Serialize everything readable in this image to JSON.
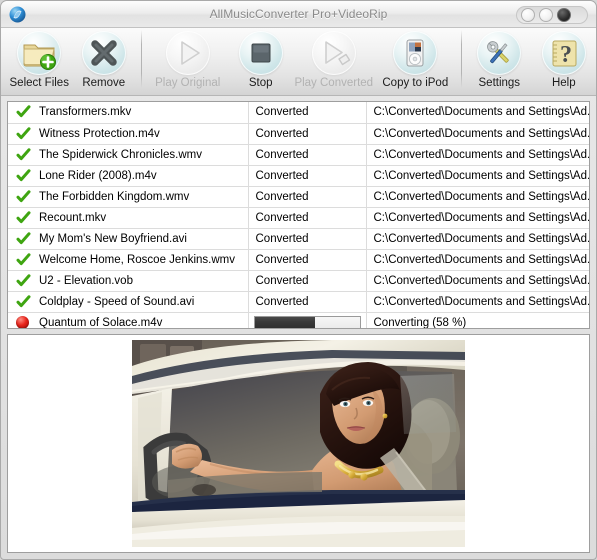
{
  "window": {
    "title": "AllMusicConverter Pro+VideoRip",
    "logo_icon": "app-logo-icon",
    "controls": [
      {
        "name": "minimize-button",
        "icon": "minimize-icon"
      },
      {
        "name": "maximize-button",
        "icon": "maximize-icon"
      },
      {
        "name": "close-button",
        "icon": "close-icon"
      }
    ]
  },
  "toolbar": {
    "items": [
      {
        "label": "Select Files",
        "icon": "folder-add-icon",
        "enabled": true,
        "name": "select-files-button"
      },
      {
        "label": "Remove",
        "icon": "x-cross-icon",
        "enabled": true,
        "name": "remove-button"
      },
      {
        "label": "Play Original",
        "icon": "play-triangle-icon",
        "enabled": false,
        "name": "play-original-button"
      },
      {
        "label": "Stop",
        "icon": "stop-square-icon",
        "enabled": true,
        "name": "stop-button"
      },
      {
        "label": "Play Converted",
        "icon": "play-converted-icon",
        "enabled": false,
        "name": "play-converted-button"
      },
      {
        "label": "Copy to iPod",
        "icon": "ipod-icon",
        "enabled": true,
        "name": "copy-to-ipod-button"
      },
      {
        "label": "Settings",
        "icon": "tools-icon",
        "enabled": true,
        "name": "settings-button"
      },
      {
        "label": "Help",
        "icon": "question-mark-icon",
        "enabled": true,
        "name": "help-button"
      }
    ]
  },
  "file_list": {
    "rows": [
      {
        "status_icon": "green-check-icon",
        "name": "Transformers.mkv",
        "status": "Converted",
        "path": "C:\\Converted\\Documents and Settings\\Ad..."
      },
      {
        "status_icon": "green-check-icon",
        "name": "Witness Protection.m4v",
        "status": "Converted",
        "path": "C:\\Converted\\Documents and Settings\\Ad..."
      },
      {
        "status_icon": "green-check-icon",
        "name": "The Spiderwick Chronicles.wmv",
        "status": "Converted",
        "path": "C:\\Converted\\Documents and Settings\\Ad..."
      },
      {
        "status_icon": "green-check-icon",
        "name": "Lone Rider (2008).m4v",
        "status": "Converted",
        "path": "C:\\Converted\\Documents and Settings\\Ad..."
      },
      {
        "status_icon": "green-check-icon",
        "name": "The Forbidden Kingdom.wmv",
        "status": "Converted",
        "path": "C:\\Converted\\Documents and Settings\\Ad..."
      },
      {
        "status_icon": "green-check-icon",
        "name": "Recount.mkv",
        "status": "Converted",
        "path": "C:\\Converted\\Documents and Settings\\Ad..."
      },
      {
        "status_icon": "green-check-icon",
        "name": "My Mom's New Boyfriend.avi",
        "status": "Converted",
        "path": "C:\\Converted\\Documents and Settings\\Ad..."
      },
      {
        "status_icon": "green-check-icon",
        "name": "Welcome Home, Roscoe Jenkins.wmv",
        "status": "Converted",
        "path": "C:\\Converted\\Documents and Settings\\Ad..."
      },
      {
        "status_icon": "green-check-icon",
        "name": "U2 - Elevation.vob",
        "status": "Converted",
        "path": "C:\\Converted\\Documents and Settings\\Ad..."
      },
      {
        "status_icon": "green-check-icon",
        "name": "Coldplay - Speed of Sound.avi",
        "status": "Converted",
        "path": "C:\\Converted\\Documents and Settings\\Ad..."
      }
    ],
    "active_row": {
      "status_icon": "red-record-icon",
      "name": "Quantum of Solace.m4v",
      "progress_percent": 58,
      "progress_label": "Converting (58 %)"
    }
  },
  "preview": {
    "name": "video-preview",
    "description": "Woman with dark bob haircut and gold necklace driving a white car, hands on steering wheel, seatbelt across shoulder"
  },
  "colors": {
    "accent_check": "#3fa511",
    "accent_record": "#e8241b",
    "progress_fill": "#393939",
    "title_text": "#8a8a8a"
  }
}
